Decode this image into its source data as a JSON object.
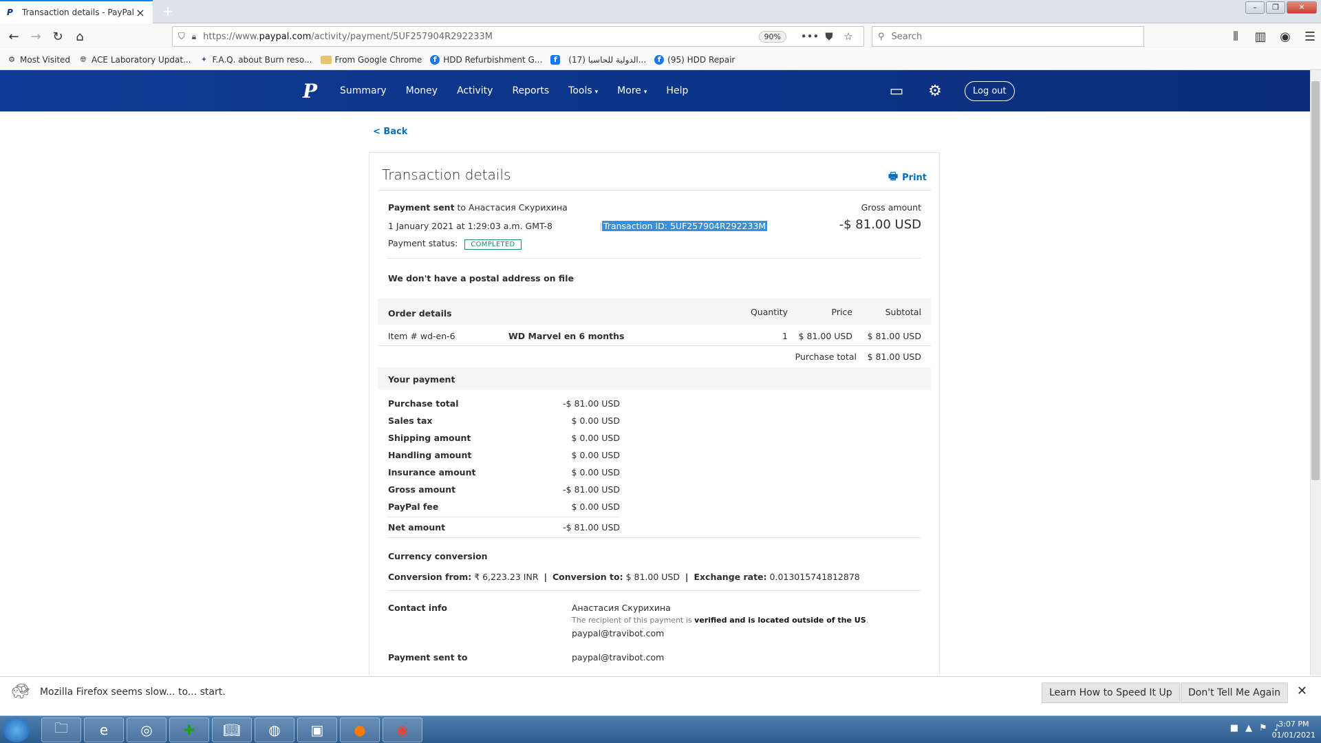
{
  "browser": {
    "tab_title": "Transaction details - PayPal",
    "url_prefix": "https://www.",
    "url_domain": "paypal.com",
    "url_path": "/activity/payment/5UF257904R292233M",
    "zoom": "90%",
    "search_placeholder": "Search",
    "bookmarks": [
      {
        "label": "Most Visited",
        "icon": "gear-icon"
      },
      {
        "label": "ACE Laboratory Updat...",
        "icon": "globe-icon"
      },
      {
        "label": "F.A.Q. about Burn reso...",
        "icon": "site-icon"
      },
      {
        "label": "From Google Chrome",
        "icon": "folder-icon"
      },
      {
        "label": "HDD Refurbishment G...",
        "icon": "facebook-icon"
      },
      {
        "label": "",
        "icon": "facebook-square-icon"
      },
      {
        "label": "(17) الدولية للحاسبا...",
        "icon": "none"
      },
      {
        "label": "(95) HDD Repair",
        "icon": "facebook-icon"
      }
    ]
  },
  "paypal": {
    "nav": [
      "Summary",
      "Money",
      "Activity",
      "Reports",
      "Tools",
      "More",
      "Help"
    ],
    "logout": "Log out",
    "back": "< Back",
    "title": "Transaction details",
    "print": "Print",
    "payment_sent_label": "Payment sent",
    "payment_sent_to": "to Анастасия Скурихина",
    "date": "1 January 2021 at 1:29:03 a.m. GMT-8",
    "transaction_id": "Transaction ID: 5UF257904R292233M",
    "gross_label": "Gross amount",
    "gross_value": "-$ 81.00 USD",
    "status_label": "Payment status:",
    "status_value": "COMPLETED",
    "postal_note": "We don't have a postal address on file",
    "order": {
      "heading": "Order details",
      "col_qty": "Quantity",
      "col_price": "Price",
      "col_subtotal": "Subtotal",
      "item_no": "Item # wd-en-6",
      "item_name": "WD Marvel en 6 months",
      "qty": "1",
      "price": "$ 81.00 USD",
      "subtotal": "$ 81.00 USD",
      "purchase_total_label": "Purchase total",
      "purchase_total": "$ 81.00 USD"
    },
    "your_payment": {
      "heading": "Your payment",
      "rows": [
        {
          "label": "Purchase total",
          "value": "-$ 81.00 USD"
        },
        {
          "label": "Sales tax",
          "value": "$ 0.00 USD"
        },
        {
          "label": "Shipping amount",
          "value": "$ 0.00 USD"
        },
        {
          "label": "Handling amount",
          "value": "$ 0.00 USD"
        },
        {
          "label": "Insurance amount",
          "value": "$ 0.00 USD"
        },
        {
          "label": "Gross amount",
          "value": "-$ 81.00 USD"
        },
        {
          "label": "PayPal fee",
          "value": "$ 0.00 USD"
        }
      ],
      "net_label": "Net amount",
      "net_value": "-$ 81.00 USD"
    },
    "currency": {
      "heading": "Currency conversion",
      "from_label": "Conversion from:",
      "from_value": "₹ 6,223.23 INR",
      "to_label": "Conversion to:",
      "to_value": "$ 81.00 USD",
      "rate_label": "Exchange rate:",
      "rate_value": "0.013015741812878",
      "sep": "|"
    },
    "contact": {
      "heading": "Contact info",
      "name": "Анастасия Скурихина",
      "note_prefix": "The recipient of this payment is",
      "note_bold": "verified and is located outside of the US",
      "note_suffix": ".",
      "email": "paypal@travibot.com"
    },
    "sent_to": {
      "heading": "Payment sent to",
      "email": "paypal@travibot.com"
    }
  },
  "notification": {
    "message": "Mozilla Firefox seems slow... to... start.",
    "learn": "Learn How to Speed It Up",
    "dismiss": "Don't Tell Me Again"
  },
  "taskbar": {
    "time": "3:07 PM",
    "date": "01/01/2021"
  },
  "colors": {
    "paypal_blue": "#0b2d7a",
    "link_blue": "#0070ba",
    "status_green": "#1a8a6e",
    "selection": "#3a8fdc"
  }
}
